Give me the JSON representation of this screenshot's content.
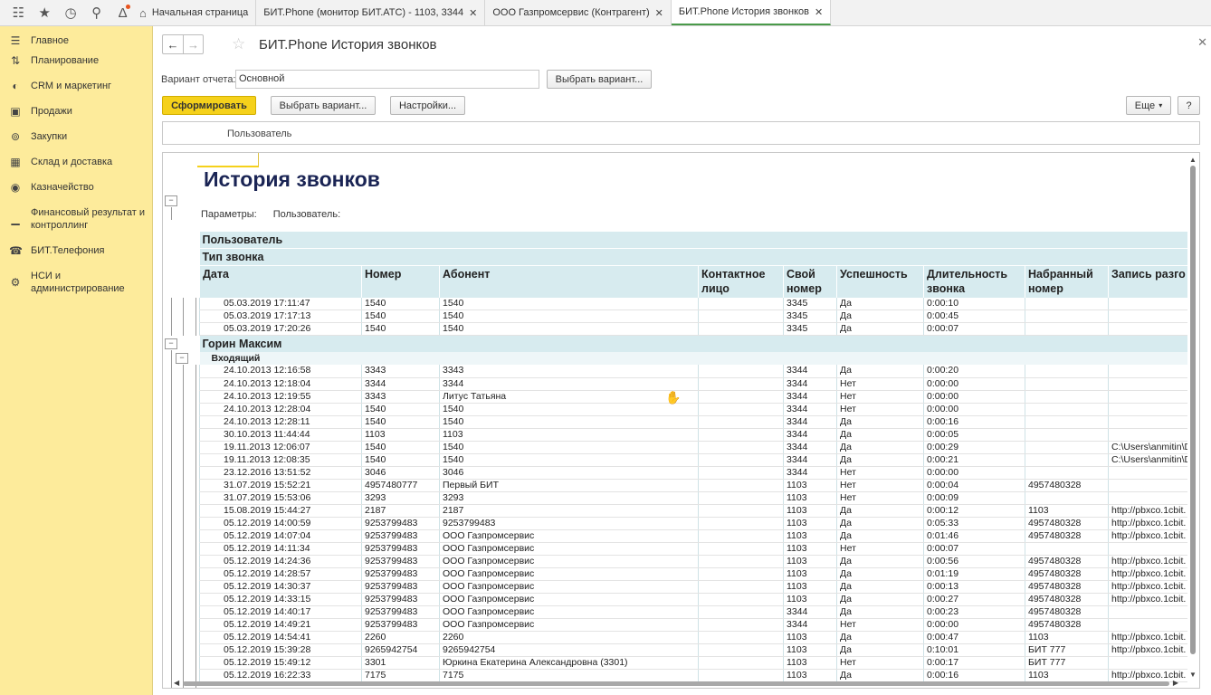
{
  "topbar": {
    "icons": [
      "apps-grid-icon",
      "star-icon",
      "history-icon",
      "search-icon",
      "bell-icon"
    ],
    "tabs": [
      {
        "label": "Начальная страница",
        "closable": false
      },
      {
        "label": "БИТ.Phone (монитор БИТ.АТС) - 1103, 3344",
        "closable": true
      },
      {
        "label": "ООО Газпромсервис (Контрагент)",
        "closable": true
      },
      {
        "label": "БИТ.Phone История звонков",
        "closable": true
      }
    ]
  },
  "sidebar": {
    "items": [
      {
        "label": "Главное",
        "icon": "menu-icon"
      },
      {
        "label": "Планирование",
        "icon": "planning-icon"
      },
      {
        "label": "CRM и маркетинг",
        "icon": "crm-icon"
      },
      {
        "label": "Продажи",
        "icon": "sales-icon"
      },
      {
        "label": "Закупки",
        "icon": "cart-icon"
      },
      {
        "label": "Склад и доставка",
        "icon": "warehouse-icon"
      },
      {
        "label": "Казначейство",
        "icon": "treasury-icon"
      },
      {
        "label": "Финансовый результат и контроллинг",
        "icon": "chart-icon"
      },
      {
        "label": "БИТ.Телефония",
        "icon": "phone-icon"
      },
      {
        "label": "НСИ и администрирование",
        "icon": "gear-icon"
      }
    ]
  },
  "page": {
    "title": "БИТ.Phone История звонков",
    "variant_label": "Вариант отчета:",
    "variant_value": "Основной",
    "select_variant_btn": "Выбрать вариант...",
    "generate_btn": "Сформировать",
    "select_variant_btn2": "Выбрать вариант...",
    "settings_btn": "Настройки...",
    "more_btn": "Еще",
    "help_btn": "?",
    "filter_label": "Пользователь"
  },
  "report": {
    "title": "История звонков",
    "params_label": "Параметры:",
    "params_value": "Пользователь:",
    "header_group1": "Пользователь",
    "header_group2": "Тип звонка",
    "columns": [
      "Дата",
      "Номер",
      "Абонент",
      "Контактное лицо",
      "Свой номер",
      "Успешность",
      "Длительность звонка",
      "Набранный номер",
      "Запись разго"
    ],
    "rows_top": [
      [
        "05.03.2019 17:11:47",
        "1540",
        "1540",
        "",
        "3345",
        "Да",
        "0:00:10",
        "",
        ""
      ],
      [
        "05.03.2019 17:17:13",
        "1540",
        "1540",
        "",
        "3345",
        "Да",
        "0:00:45",
        "",
        ""
      ],
      [
        "05.03.2019 17:20:26",
        "1540",
        "1540",
        "",
        "3345",
        "Да",
        "0:00:07",
        "",
        ""
      ]
    ],
    "group_user": "Горин Максим",
    "group_type": "Входящий",
    "rows": [
      [
        "24.10.2013 12:16:58",
        "3343",
        "3343",
        "",
        "3344",
        "Да",
        "0:00:20",
        "",
        ""
      ],
      [
        "24.10.2013 12:18:04",
        "3344",
        "3344",
        "",
        "3344",
        "Нет",
        "0:00:00",
        "",
        ""
      ],
      [
        "24.10.2013 12:19:55",
        "3343",
        "Литус Татьяна",
        "",
        "3344",
        "Нет",
        "0:00:00",
        "",
        ""
      ],
      [
        "24.10.2013 12:28:04",
        "1540",
        "1540",
        "",
        "3344",
        "Нет",
        "0:00:00",
        "",
        ""
      ],
      [
        "24.10.2013 12:28:11",
        "1540",
        "1540",
        "",
        "3344",
        "Да",
        "0:00:16",
        "",
        ""
      ],
      [
        "30.10.2013 11:44:44",
        "1103",
        "1103",
        "",
        "3344",
        "Да",
        "0:00:05",
        "",
        ""
      ],
      [
        "19.11.2013 12:06:07",
        "1540",
        "1540",
        "",
        "3344",
        "Да",
        "0:00:29",
        "",
        "C:\\Users\\anmitin\\D"
      ],
      [
        "19.11.2013 12:08:35",
        "1540",
        "1540",
        "",
        "3344",
        "Да",
        "0:00:21",
        "",
        "C:\\Users\\anmitin\\D"
      ],
      [
        "23.12.2016 13:51:52",
        "3046",
        "3046",
        "",
        "3344",
        "Нет",
        "0:00:00",
        "",
        ""
      ],
      [
        "31.07.2019 15:52:21",
        "4957480777",
        "Первый БИТ",
        "",
        "1103",
        "Нет",
        "0:00:04",
        "4957480328",
        ""
      ],
      [
        "31.07.2019 15:53:06",
        "3293",
        "3293",
        "",
        "1103",
        "Нет",
        "0:00:09",
        "",
        ""
      ],
      [
        "15.08.2019 15:44:27",
        "2187",
        "2187",
        "",
        "1103",
        "Да",
        "0:00:12",
        "1103",
        "http://pbxco.1cbit."
      ],
      [
        "05.12.2019 14:00:59",
        "9253799483",
        "9253799483",
        "",
        "1103",
        "Да",
        "0:05:33",
        "4957480328",
        "http://pbxco.1cbit."
      ],
      [
        "05.12.2019 14:07:04",
        "9253799483",
        "ООО Газпромсервис",
        "",
        "1103",
        "Да",
        "0:01:46",
        "4957480328",
        "http://pbxco.1cbit."
      ],
      [
        "05.12.2019 14:11:34",
        "9253799483",
        "ООО Газпромсервис",
        "",
        "1103",
        "Нет",
        "0:00:07",
        "",
        ""
      ],
      [
        "05.12.2019 14:24:36",
        "9253799483",
        "ООО Газпромсервис",
        "",
        "1103",
        "Да",
        "0:00:56",
        "4957480328",
        "http://pbxco.1cbit."
      ],
      [
        "05.12.2019 14:28:57",
        "9253799483",
        "ООО Газпромсервис",
        "",
        "1103",
        "Да",
        "0:01:19",
        "4957480328",
        "http://pbxco.1cbit."
      ],
      [
        "05.12.2019 14:30:37",
        "9253799483",
        "ООО Газпромсервис",
        "",
        "1103",
        "Да",
        "0:00:13",
        "4957480328",
        "http://pbxco.1cbit."
      ],
      [
        "05.12.2019 14:33:15",
        "9253799483",
        "ООО Газпромсервис",
        "",
        "1103",
        "Да",
        "0:00:27",
        "4957480328",
        "http://pbxco.1cbit."
      ],
      [
        "05.12.2019 14:40:17",
        "9253799483",
        "ООО Газпромсервис",
        "",
        "3344",
        "Да",
        "0:00:23",
        "4957480328",
        ""
      ],
      [
        "05.12.2019 14:49:21",
        "9253799483",
        "ООО Газпромсервис",
        "",
        "3344",
        "Нет",
        "0:00:00",
        "4957480328",
        ""
      ],
      [
        "05.12.2019 14:54:41",
        "2260",
        "2260",
        "",
        "1103",
        "Да",
        "0:00:47",
        "1103",
        "http://pbxco.1cbit."
      ],
      [
        "05.12.2019 15:39:28",
        "9265942754",
        "9265942754",
        "",
        "1103",
        "Да",
        "0:10:01",
        "БИТ 777",
        "http://pbxco.1cbit."
      ],
      [
        "05.12.2019 15:49:12",
        "3301",
        "Юркина Екатерина Александровна (3301)",
        "",
        "1103",
        "Нет",
        "0:00:17",
        "БИТ 777",
        ""
      ],
      [
        "05.12.2019 16:22:33",
        "7175",
        "7175",
        "",
        "1103",
        "Да",
        "0:00:16",
        "1103",
        "http://pbxco.1cbit."
      ]
    ]
  },
  "colors": {
    "accent_yellow": "#f5d11b",
    "sidebar_bg": "#fdeb9b",
    "header_bg": "#d7ebef",
    "title_blue": "#1a2454"
  }
}
